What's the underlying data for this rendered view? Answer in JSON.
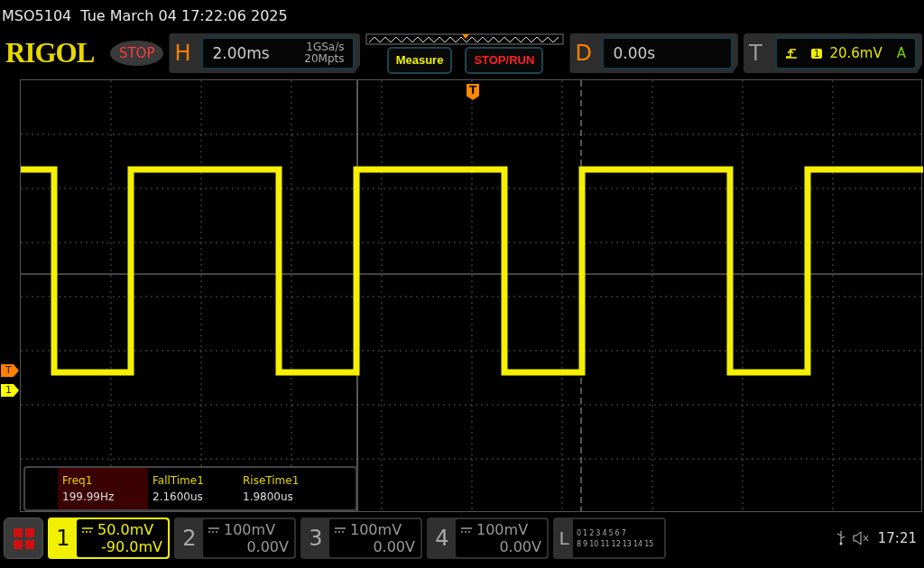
{
  "header": {
    "model": "MSO5104",
    "datetime": "Tue March 04 17:22:06 2025"
  },
  "toolbar": {
    "logo": "RIGOL",
    "run_state": "STOP",
    "horizontal": {
      "letter": "H",
      "timebase": "2.00ms",
      "sample_rate": "1GSa/s",
      "memory_depth": "20Mpts"
    },
    "measure_button": "Measure",
    "stop_run_button": "STOP/RUN",
    "delay": {
      "letter": "D",
      "value": "0.00s"
    },
    "trigger": {
      "letter": "T",
      "source": "1",
      "level": "20.6mV",
      "mode": "A"
    }
  },
  "screen": {
    "trigger_tag": "T",
    "markers": [
      {
        "label": "T",
        "color": "#ff7f00"
      },
      {
        "label": "1",
        "color": "#ffff00"
      }
    ],
    "measurements": [
      {
        "name": "Freq1",
        "value": "199.99Hz",
        "selected": true
      },
      {
        "name": "FallTime1",
        "value": "2.1600us",
        "selected": false
      },
      {
        "name": "RiseTime1",
        "value": "1.9800us",
        "selected": false
      }
    ]
  },
  "channels": [
    {
      "number": "1",
      "scale": "50.0mV",
      "offset": "-90.0mV",
      "selected": true
    },
    {
      "number": "2",
      "scale": "100mV",
      "offset": "0.00V",
      "selected": false
    },
    {
      "number": "3",
      "scale": "100mV",
      "offset": "0.00V",
      "selected": false
    },
    {
      "number": "4",
      "scale": "100mV",
      "offset": "0.00V",
      "selected": false
    }
  ],
  "logic": {
    "letter": "L",
    "row_1": [
      "0",
      "1",
      "2",
      "3",
      "4",
      "5",
      "6",
      "7"
    ],
    "row_2": [
      "8",
      "9",
      "10",
      "11",
      "12",
      "13",
      "14",
      "15"
    ]
  },
  "status": {
    "time": "17:21"
  }
}
